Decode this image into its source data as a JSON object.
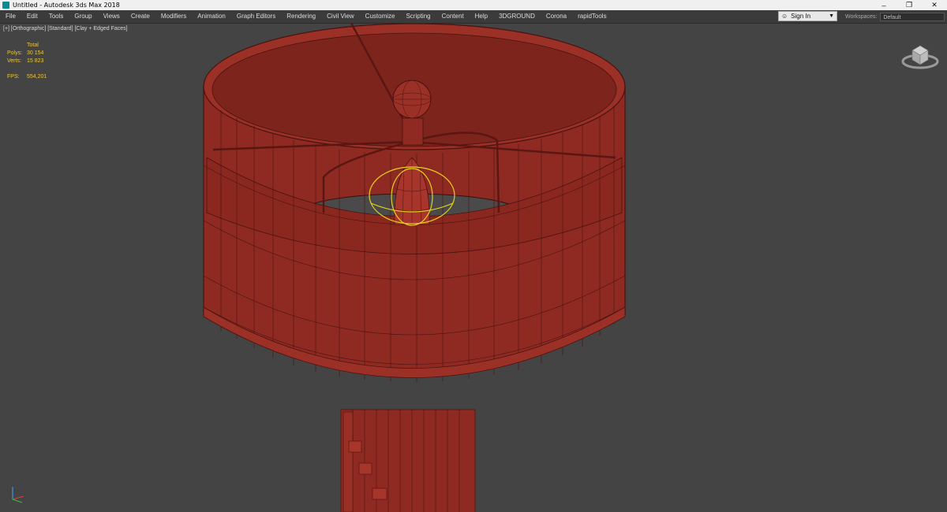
{
  "window": {
    "title": "Untitled - Autodesk 3ds Max 2018",
    "controls": {
      "minimize": "–",
      "restore": "❐",
      "close": "✕"
    }
  },
  "menu": {
    "items": [
      "File",
      "Edit",
      "Tools",
      "Group",
      "Views",
      "Create",
      "Modifiers",
      "Animation",
      "Graph Editors",
      "Rendering",
      "Civil View",
      "Customize",
      "Scripting",
      "Content",
      "Help",
      "3DGROUND",
      "Corona",
      "rapidTools"
    ]
  },
  "account": {
    "signin_label": "Sign In",
    "workspaces_label": "Workspaces:",
    "workspace_value": "Default"
  },
  "viewport": {
    "label": "[+] [Orthographic] [Standard] [Clay + Edged Faces]",
    "stats": {
      "total_label": "Total",
      "polys_label": "Polys:",
      "polys_value": "30 154",
      "verts_label": "Verts:",
      "verts_value": "15 823",
      "fps_label": "FPS:",
      "fps_value": "554,201"
    }
  },
  "colors": {
    "background": "#444444",
    "model_red": "#8e2a22",
    "model_dark": "#5a1712",
    "stats_text": "#e8c648",
    "selection": "#e6d21e"
  }
}
